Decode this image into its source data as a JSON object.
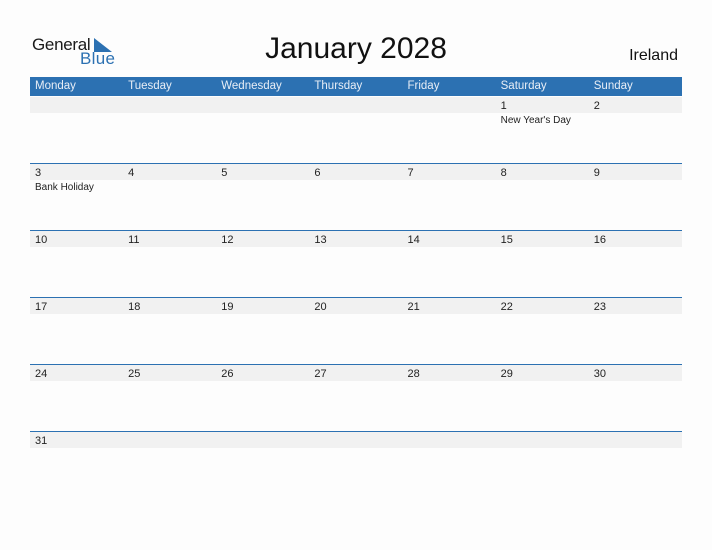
{
  "logo": {
    "general": "General",
    "blue": "Blue"
  },
  "title": "January 2028",
  "country": "Ireland",
  "colors": {
    "accent": "#2c71b2",
    "strip": "#f1f1f1"
  },
  "weekdays": [
    "Monday",
    "Tuesday",
    "Wednesday",
    "Thursday",
    "Friday",
    "Saturday",
    "Sunday"
  ],
  "weeks": [
    [
      {
        "d": ""
      },
      {
        "d": ""
      },
      {
        "d": ""
      },
      {
        "d": ""
      },
      {
        "d": ""
      },
      {
        "d": "1",
        "h": "New Year's Day"
      },
      {
        "d": "2"
      }
    ],
    [
      {
        "d": "3",
        "h": "Bank Holiday"
      },
      {
        "d": "4"
      },
      {
        "d": "5"
      },
      {
        "d": "6"
      },
      {
        "d": "7"
      },
      {
        "d": "8"
      },
      {
        "d": "9"
      }
    ],
    [
      {
        "d": "10"
      },
      {
        "d": "11"
      },
      {
        "d": "12"
      },
      {
        "d": "13"
      },
      {
        "d": "14"
      },
      {
        "d": "15"
      },
      {
        "d": "16"
      }
    ],
    [
      {
        "d": "17"
      },
      {
        "d": "18"
      },
      {
        "d": "19"
      },
      {
        "d": "20"
      },
      {
        "d": "21"
      },
      {
        "d": "22"
      },
      {
        "d": "23"
      }
    ],
    [
      {
        "d": "24"
      },
      {
        "d": "25"
      },
      {
        "d": "26"
      },
      {
        "d": "27"
      },
      {
        "d": "28"
      },
      {
        "d": "29"
      },
      {
        "d": "30"
      }
    ],
    [
      {
        "d": "31"
      },
      {
        "d": ""
      },
      {
        "d": ""
      },
      {
        "d": ""
      },
      {
        "d": ""
      },
      {
        "d": ""
      },
      {
        "d": ""
      }
    ]
  ]
}
